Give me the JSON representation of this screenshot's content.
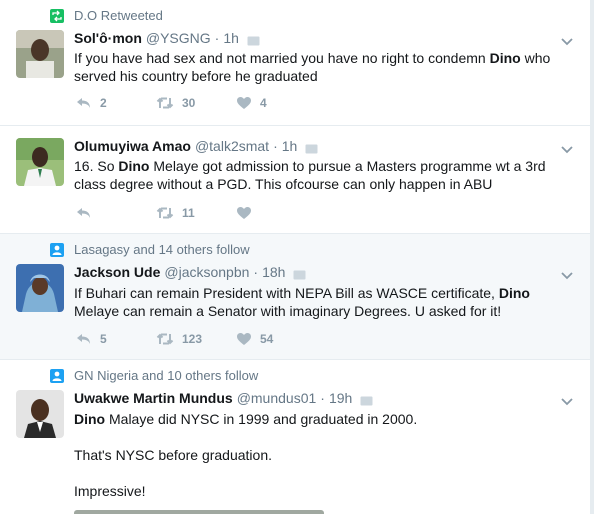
{
  "colors": {
    "context_icon_rt": "#17bf63",
    "context_icon_follow": "#1da1f2",
    "muted": "#657786",
    "highlight_bg": "#f5f8fa"
  },
  "tweets": [
    {
      "context": "D.O Retweeted",
      "context_icon": "retweet-icon",
      "name": "Sol'ô·mon",
      "handle": "@YSGNG",
      "time": "1h",
      "text_parts": [
        "If you have had sex and not married you have no right to condemn ",
        "Dino",
        " who served his country before he graduated"
      ],
      "replies": "2",
      "retweets": "30",
      "likes": "4"
    },
    {
      "name": "Olumuyiwa Amao",
      "handle": "@talk2smat",
      "time": "1h",
      "text_parts": [
        "16. So ",
        "Dino",
        " Melaye got admission to pursue a  Masters programme wt a 3rd class degree without a PGD. This ofcourse can only happen in ABU"
      ],
      "replies": "",
      "retweets": "11",
      "likes": ""
    },
    {
      "context": "Lasagasy and 14 others follow",
      "context_icon": "person-icon",
      "name": "Jackson Ude",
      "handle": "@jacksonpbn",
      "time": "18h",
      "text_parts": [
        "If Buhari can remain President with NEPA Bill as WASCE certificate, ",
        "Dino",
        " Melaye can remain a Senator with imaginary Degrees. U asked for it!"
      ],
      "replies": "5",
      "retweets": "123",
      "likes": "54"
    },
    {
      "context": "GN Nigeria and 10 others follow",
      "context_icon": "person-icon",
      "name": "Uwakwe Martin Mundus",
      "handle": "@mundus01",
      "time": "19h",
      "text_parts": [
        "Dino",
        " Malaye did NYSC in 1999 and graduated in 2000."
      ],
      "para2": "That's NYSC before graduation.",
      "para3": "Impressive!"
    }
  ],
  "separator": "·"
}
